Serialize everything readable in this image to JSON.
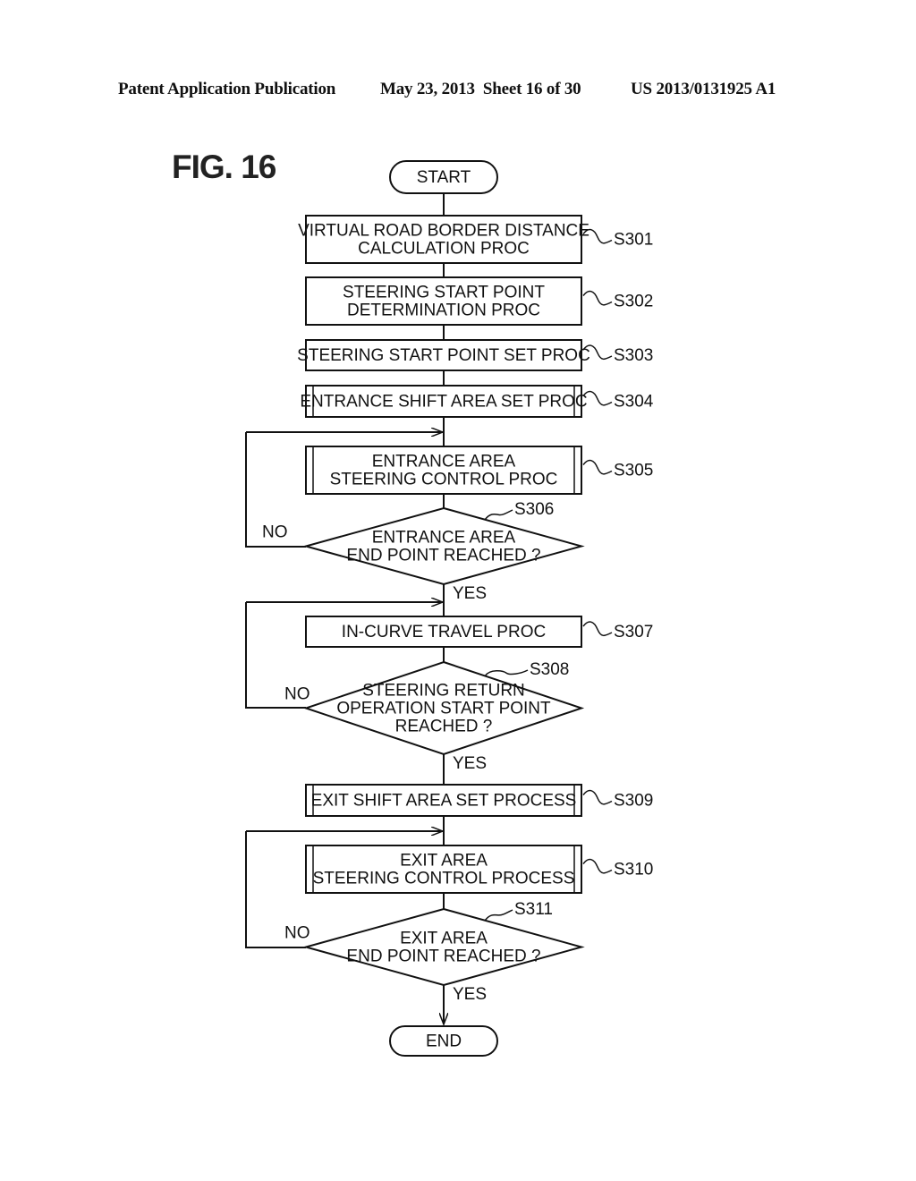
{
  "header": {
    "publication": "Patent Application Publication",
    "date_sheet": "May 23, 2013  Sheet 16 of 30",
    "number": "US 2013/0131925 A1"
  },
  "figure": {
    "title": "FIG. 16"
  },
  "flowchart": {
    "start": "START",
    "end": "END",
    "steps": [
      {
        "id": "S301",
        "type": "process",
        "lines": [
          "VIRTUAL ROAD BORDER DISTANCE",
          "CALCULATION PROC"
        ]
      },
      {
        "id": "S302",
        "type": "process",
        "lines": [
          "STEERING START POINT",
          "DETERMINATION PROC"
        ]
      },
      {
        "id": "S303",
        "type": "process",
        "lines": [
          "STEERING START POINT SET PROC"
        ]
      },
      {
        "id": "S304",
        "type": "subroutine",
        "lines": [
          "ENTRANCE SHIFT AREA SET PROC"
        ]
      },
      {
        "id": "S305",
        "type": "subroutine",
        "lines": [
          "ENTRANCE AREA",
          "STEERING CONTROL PROC"
        ]
      },
      {
        "id": "S306",
        "type": "decision",
        "lines": [
          "ENTRANCE AREA",
          "END POINT REACHED ?"
        ],
        "no": "NO",
        "yes": "YES"
      },
      {
        "id": "S307",
        "type": "process",
        "lines": [
          "IN-CURVE TRAVEL PROC"
        ]
      },
      {
        "id": "S308",
        "type": "decision",
        "lines": [
          "STEERING RETURN",
          "OPERATION START POINT",
          "REACHED ?"
        ],
        "no": "NO",
        "yes": "YES"
      },
      {
        "id": "S309",
        "type": "subroutine",
        "lines": [
          "EXIT SHIFT AREA SET PROCESS"
        ]
      },
      {
        "id": "S310",
        "type": "subroutine",
        "lines": [
          "EXIT AREA",
          "STEERING CONTROL PROCESS"
        ]
      },
      {
        "id": "S311",
        "type": "decision",
        "lines": [
          "EXIT AREA",
          "END POINT REACHED ?"
        ],
        "no": "NO",
        "yes": "YES"
      }
    ]
  }
}
